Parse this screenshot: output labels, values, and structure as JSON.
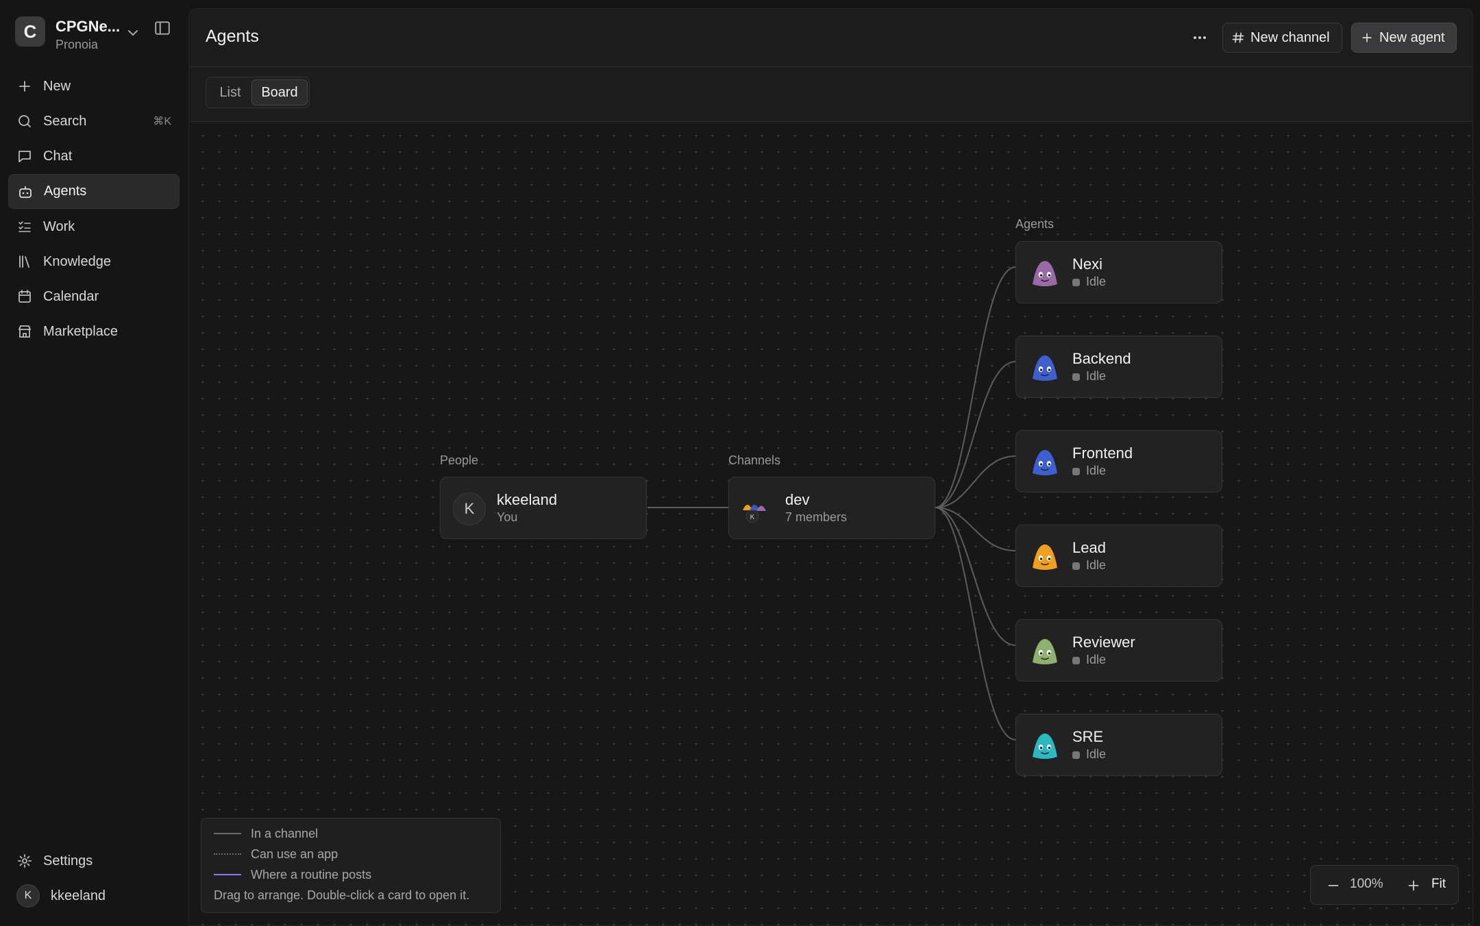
{
  "workspace": {
    "initial": "C",
    "name": "CPGNe...",
    "subtitle": "Pronoia"
  },
  "nav": [
    {
      "label": "New",
      "icon": "plus-icon"
    },
    {
      "label": "Search",
      "icon": "search-icon",
      "shortcut": "⌘K"
    },
    {
      "label": "Chat",
      "icon": "chat-icon"
    },
    {
      "label": "Agents",
      "icon": "bot-icon",
      "active": true
    },
    {
      "label": "Work",
      "icon": "list-check-icon"
    },
    {
      "label": "Knowledge",
      "icon": "library-icon"
    },
    {
      "label": "Calendar",
      "icon": "calendar-icon"
    },
    {
      "label": "Marketplace",
      "icon": "store-icon"
    }
  ],
  "sidebar_bottom": {
    "settings_label": "Settings",
    "user_initial": "K",
    "user_name": "kkeeland"
  },
  "header": {
    "title": "Agents",
    "new_channel_label": "New channel",
    "new_agent_label": "New agent"
  },
  "view_toggle": {
    "options": [
      "List",
      "Board"
    ],
    "selected": "Board"
  },
  "board": {
    "columns": {
      "people": "People",
      "channels": "Channels",
      "agents": "Agents"
    },
    "person": {
      "initial": "K",
      "name": "kkeeland",
      "sub": "You"
    },
    "channel": {
      "name": "dev",
      "sub": "7 members",
      "mini_initial": "K"
    },
    "agents": [
      {
        "name": "Nexi",
        "status": "Idle",
        "color": "#9a6aa8"
      },
      {
        "name": "Backend",
        "status": "Idle",
        "color": "#3f5fd0"
      },
      {
        "name": "Frontend",
        "status": "Idle",
        "color": "#3f5fd0"
      },
      {
        "name": "Lead",
        "status": "Idle",
        "color": "#f0a020"
      },
      {
        "name": "Reviewer",
        "status": "Idle",
        "color": "#8fb070"
      },
      {
        "name": "SRE",
        "status": "Idle",
        "color": "#2bb8c0"
      }
    ]
  },
  "legend": {
    "items": [
      {
        "label": "In a channel",
        "style": "solid",
        "color": "#6b6b6b"
      },
      {
        "label": "Can use an app",
        "style": "dotted",
        "color": "#6b6b6b"
      },
      {
        "label": "Where a routine posts",
        "style": "solid",
        "color": "#8a7cf0"
      }
    ],
    "hint": "Drag to arrange. Double-click a card to open it."
  },
  "zoom": {
    "level": "100%",
    "fit_label": "Fit"
  }
}
